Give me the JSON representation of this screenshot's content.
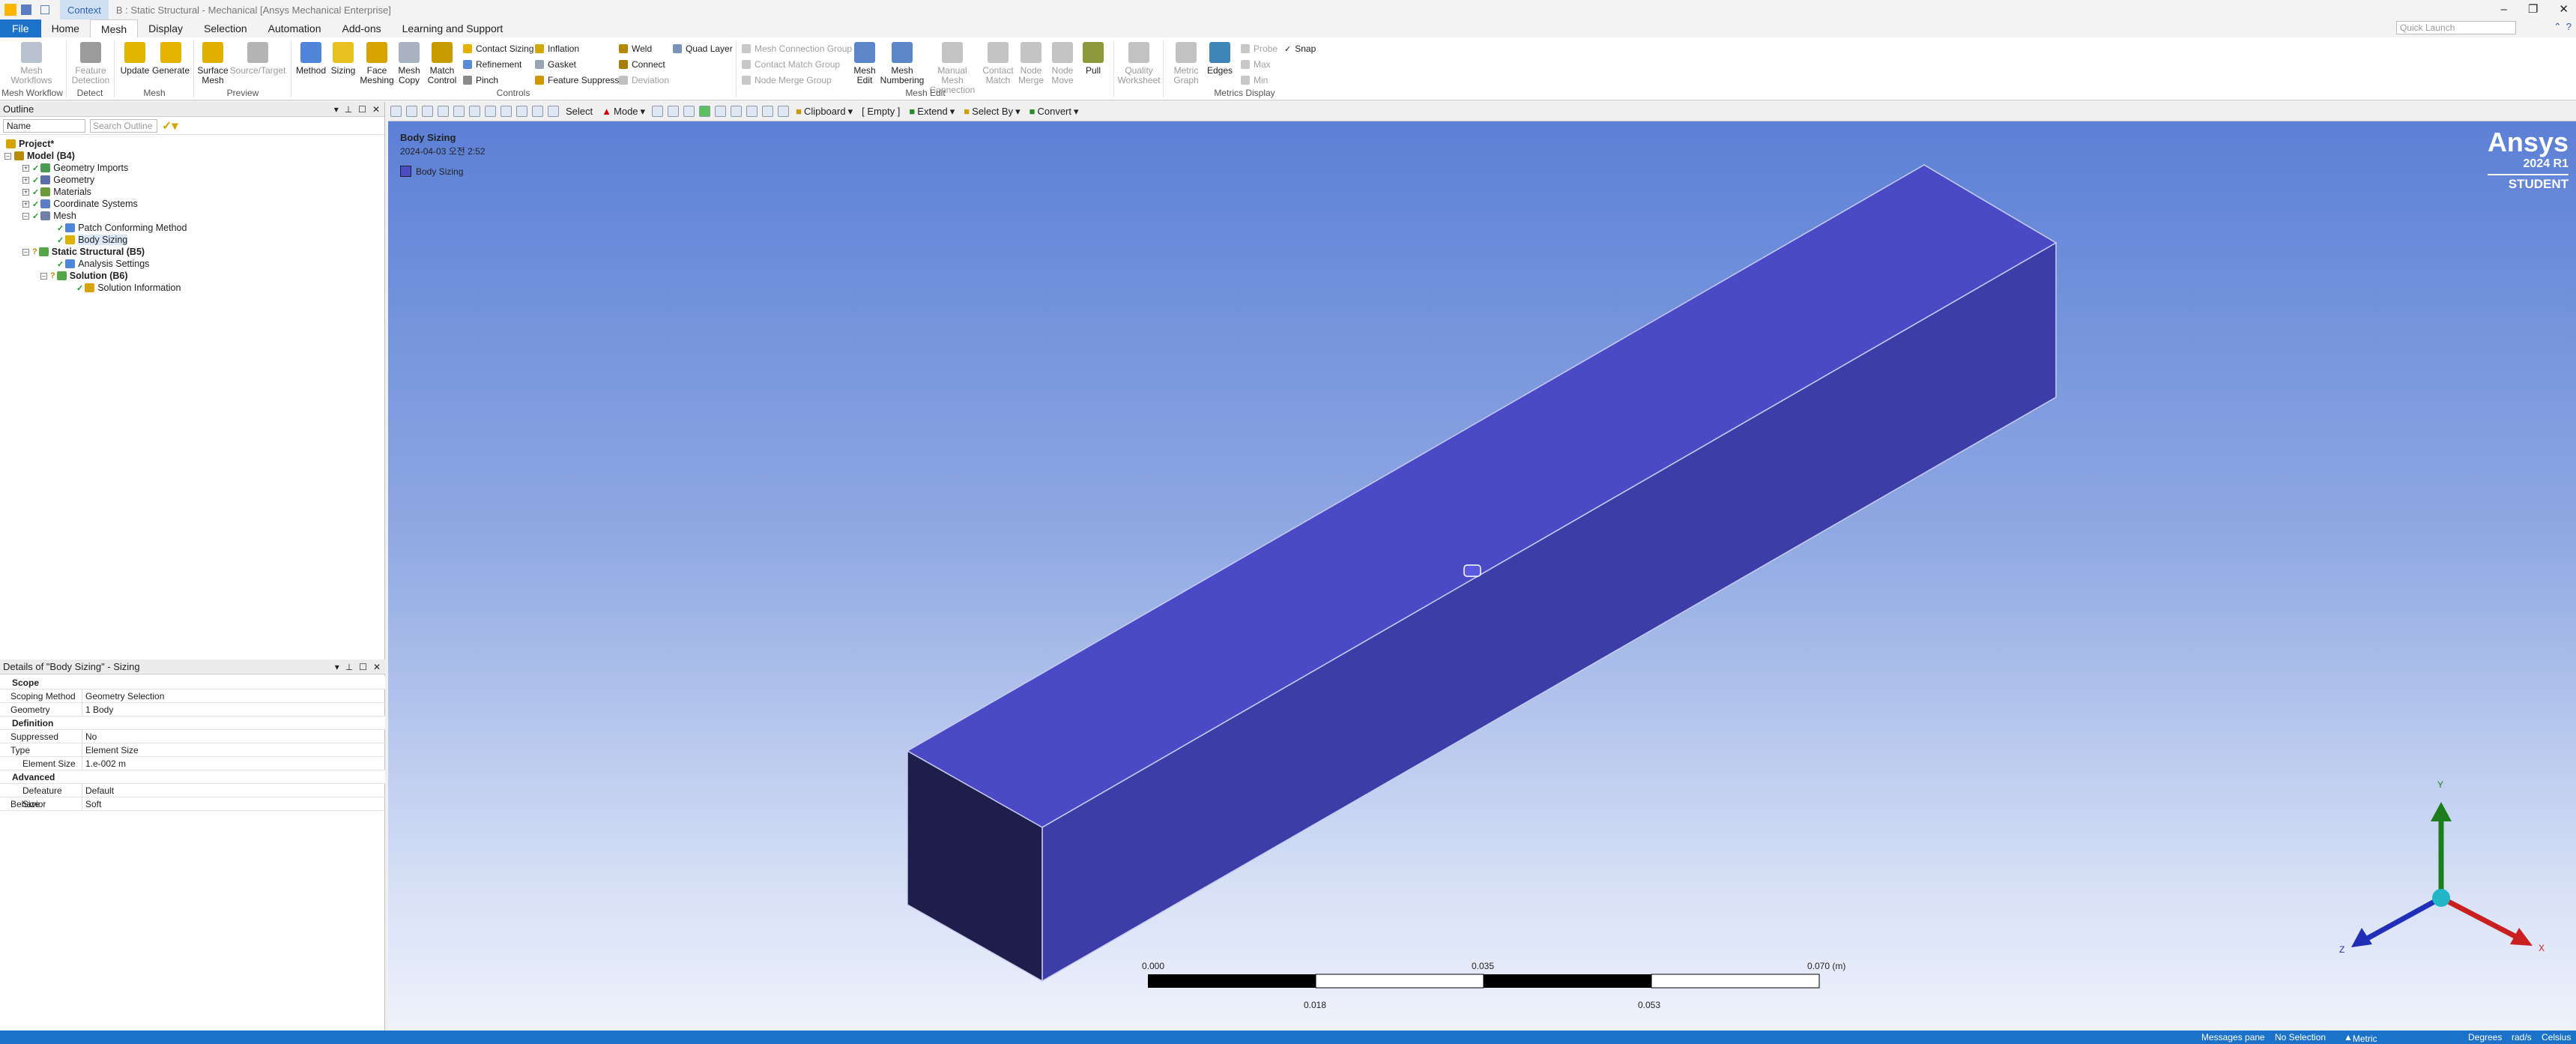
{
  "titlebar": {
    "context_tab": "Context",
    "title": "B : Static Structural - Mechanical [Ansys Mechanical Enterprise]"
  },
  "tabs": [
    "File",
    "Home",
    "Mesh",
    "Display",
    "Selection",
    "Automation",
    "Add-ons",
    "Learning and Support"
  ],
  "quick_launch": "Quick Launch",
  "ribbon": {
    "mesh_workflow": "Mesh Workflows",
    "feature_detection": "Feature Detection",
    "update": "Update",
    "generate": "Generate",
    "surface_mesh": "Surface Mesh",
    "source_target": "Source/Target",
    "method": "Method",
    "sizing": "Sizing",
    "face_meshing": "Face Meshing",
    "mesh_copy": "Mesh Copy",
    "match_control": "Match Control",
    "contact_sizing": "Contact Sizing",
    "refinement": "Refinement",
    "pinch": "Pinch",
    "inflation": "Inflation",
    "gasket": "Gasket",
    "feature_suppress": "Feature Suppress",
    "weld": "Weld",
    "connect": "Connect",
    "deviation": "Deviation",
    "quad_layer": "Quad Layer",
    "mesh_connection_group": "Mesh Connection Group",
    "contact_match_group": "Contact Match Group",
    "node_merge_group": "Node Merge Group",
    "mesh_edit": "Mesh Edit",
    "mesh_numbering": "Mesh Numbering",
    "manual_mesh_connection": "Manual Mesh Connection",
    "contact_match": "Contact Match",
    "node_merge": "Node Merge",
    "node_move": "Node Move",
    "pull": "Pull",
    "quality_worksheet": "Quality Worksheet",
    "metric_graph": "Metric Graph",
    "edges": "Edges",
    "probe": "Probe",
    "max": "Max",
    "min": "Min",
    "snap": "Snap",
    "groups": {
      "mesh_workflow": "Mesh Workflow",
      "detect": "Detect",
      "mesh": "Mesh",
      "preview": "Preview",
      "controls": "Controls",
      "mesh_edit": "Mesh Edit",
      "metrics_display": "Metrics Display"
    }
  },
  "toolbar2": {
    "select": "Select",
    "mode": "Mode",
    "clipboard": "Clipboard",
    "empty": "[ Empty ]",
    "extend": "Extend",
    "select_by": "Select By",
    "convert": "Convert"
  },
  "outline": {
    "title": "Outline",
    "filter": "Name",
    "search_placeholder": "Search Outline",
    "items": [
      "Project*",
      "Model (B4)",
      "Geometry Imports",
      "Geometry",
      "Materials",
      "Coordinate Systems",
      "Mesh",
      "Patch Conforming Method",
      "Body Sizing",
      "Static Structural (B5)",
      "Analysis Settings",
      "Solution (B6)",
      "Solution Information"
    ]
  },
  "details": {
    "title": "Details of \"Body Sizing\" - Sizing",
    "sections": {
      "scope": "Scope",
      "definition": "Definition",
      "advanced": "Advanced"
    },
    "rows": [
      {
        "label": "Scoping Method",
        "value": "Geometry Selection"
      },
      {
        "label": "Geometry",
        "value": "1 Body"
      },
      {
        "label": "Suppressed",
        "value": "No"
      },
      {
        "label": "Type",
        "value": "Element Size"
      },
      {
        "label": "Element Size",
        "value": "1.e-002 m"
      },
      {
        "label": "Defeature Size",
        "value": "Default"
      },
      {
        "label": "Behavior",
        "value": "Soft"
      }
    ]
  },
  "viewport": {
    "title": "Body Sizing",
    "date": "2024-04-03 오전 2:52",
    "legend": "Body Sizing",
    "logo": {
      "brand": "Ansys",
      "version": "2024 R1",
      "edition": "STUDENT"
    },
    "scale": {
      "top": [
        "0.000",
        "0.035",
        "0.070 (m)"
      ],
      "bottom": [
        "0.018",
        "0.053"
      ]
    },
    "axes": {
      "x": "X",
      "y": "Y",
      "z": "Z"
    },
    "colors": {
      "body_top": "#4b4ac6",
      "body_front": "#3d3da8",
      "body_end": "#1e1e4a"
    }
  },
  "statusbar": {
    "messages": "Messages pane",
    "selection": "No Selection",
    "units": "Metric (m, kg, N, s, V, A)",
    "angle": "Degrees",
    "rate": "rad/s",
    "temp": "Celsius"
  }
}
